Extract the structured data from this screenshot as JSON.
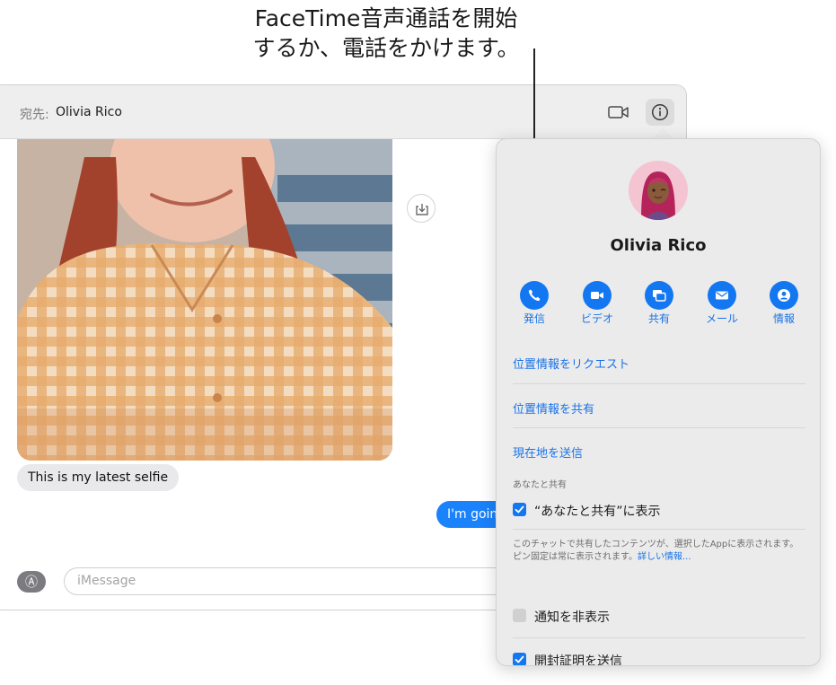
{
  "callout": {
    "line1": "FaceTime音声通話を開始",
    "line2": "するか、電話をかけます。"
  },
  "header": {
    "to_label": "宛先:",
    "to_name": "Olivia Rico"
  },
  "conversation": {
    "incoming_message": "This is my latest selfie",
    "outgoing_message": "I'm going"
  },
  "composer": {
    "placeholder": "iMessage"
  },
  "popover": {
    "contact_name": "Olivia Rico",
    "actions": [
      {
        "label": "発信",
        "icon": "phone-icon"
      },
      {
        "label": "ビデオ",
        "icon": "video-icon"
      },
      {
        "label": "共有",
        "icon": "screen-share-icon"
      },
      {
        "label": "メール",
        "icon": "mail-icon"
      },
      {
        "label": "情報",
        "icon": "person-icon"
      }
    ],
    "links": {
      "request_location": "位置情報をリクエスト",
      "share_location": "位置情報を共有",
      "send_current_location": "現在地を送信"
    },
    "shared_with_you_section": "あなたと共有",
    "show_in_shared": {
      "label": "“あなたと共有”に表示",
      "checked": true
    },
    "description": "このチャットで共有したコンテンツが、選択したAppに表示されます。ピン固定は常に表示されます。",
    "more_info": "詳しい情報...",
    "hide_alerts": {
      "label": "通知を非表示",
      "checked": false
    },
    "send_read_receipts": {
      "label": "開封証明を送信",
      "checked": true
    }
  },
  "colors": {
    "accent": "#1477f2",
    "link": "#1a73e8",
    "outgoing_bubble": "#1a82fb",
    "incoming_bubble": "#e9e9eb"
  }
}
